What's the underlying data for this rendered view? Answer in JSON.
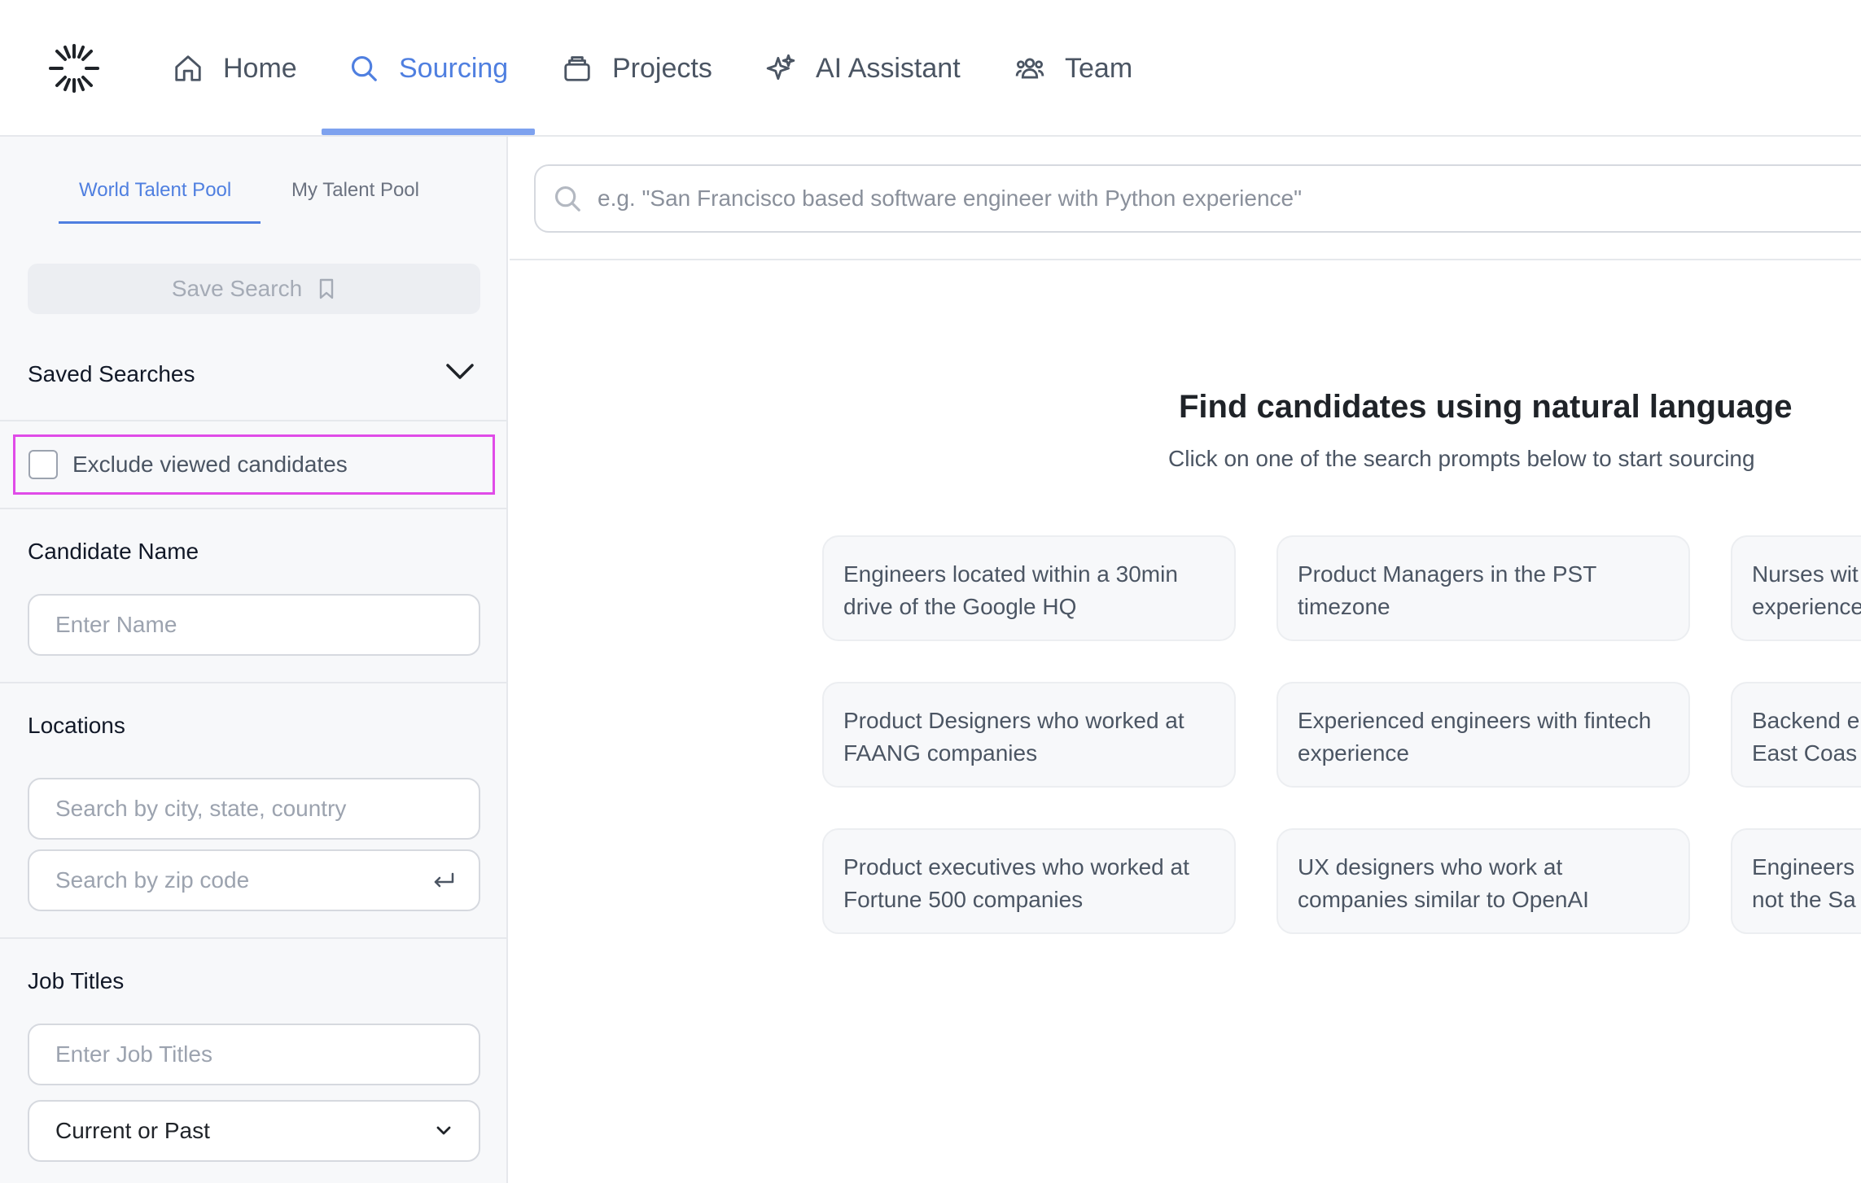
{
  "nav": {
    "items": [
      {
        "label": "Home",
        "icon": "home-icon"
      },
      {
        "label": "Sourcing",
        "icon": "search-icon",
        "active": true
      },
      {
        "label": "Projects",
        "icon": "projects-icon"
      },
      {
        "label": "AI Assistant",
        "icon": "sparkles-icon"
      },
      {
        "label": "Team",
        "icon": "team-icon"
      }
    ]
  },
  "sidebar": {
    "tabs": [
      "World Talent Pool",
      "My Talent Pool"
    ],
    "active_tab": "World Talent Pool",
    "save_search_label": "Save Search",
    "saved_searches_title": "Saved Searches",
    "exclude_viewed_label": "Exclude viewed candidates",
    "exclude_viewed_checked": false,
    "candidate_name_title": "Candidate Name",
    "candidate_name_placeholder": "Enter Name",
    "locations_title": "Locations",
    "location_placeholder": "Search by city, state, country",
    "zip_placeholder": "Search by zip code",
    "job_titles_title": "Job Titles",
    "job_titles_placeholder": "Enter Job Titles",
    "job_time_select": "Current or Past"
  },
  "main": {
    "search_placeholder": "e.g. \"San Francisco based software engineer with Python experience\"",
    "hero_title": "Find candidates using natural language",
    "hero_subtitle": "Click on one of the search prompts below to start sourcing",
    "prompts": [
      "Engineers located within a 30min drive of the Google HQ",
      "Product Managers in the PST timezone",
      "Nurses wit experience",
      "Product Designers who worked at FAANG companies",
      "Experienced engineers with fintech experience",
      "Backend e East Coas",
      "Product executives who worked at Fortune 500 companies",
      "UX designers who work at companies similar to OpenAI",
      "Engineers not the Sa"
    ]
  },
  "colors": {
    "accent": "#4f7fe0",
    "highlight_border": "#e04be8"
  }
}
